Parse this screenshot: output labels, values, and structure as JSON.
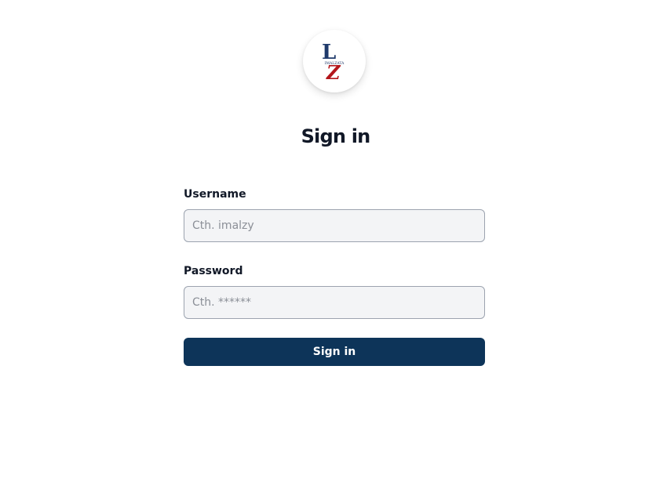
{
  "logo": {
    "alt": "Logo",
    "initials": [
      "L",
      "Z"
    ],
    "text": "IMALZATA",
    "colors": {
      "primary": "#1f3a6b",
      "accent": "#b3161b"
    }
  },
  "page_title": "Sign in",
  "form": {
    "username": {
      "label": "Username",
      "placeholder": "Cth. imalzy",
      "value": ""
    },
    "password": {
      "label": "Password",
      "placeholder": "Cth. ******",
      "value": ""
    },
    "submit_label": "Sign in"
  },
  "colors": {
    "button_bg": "#0d3459",
    "button_text": "#ffffff",
    "input_bg": "#f3f4f6",
    "input_border": "#9ca3af",
    "title_text": "#111827"
  }
}
